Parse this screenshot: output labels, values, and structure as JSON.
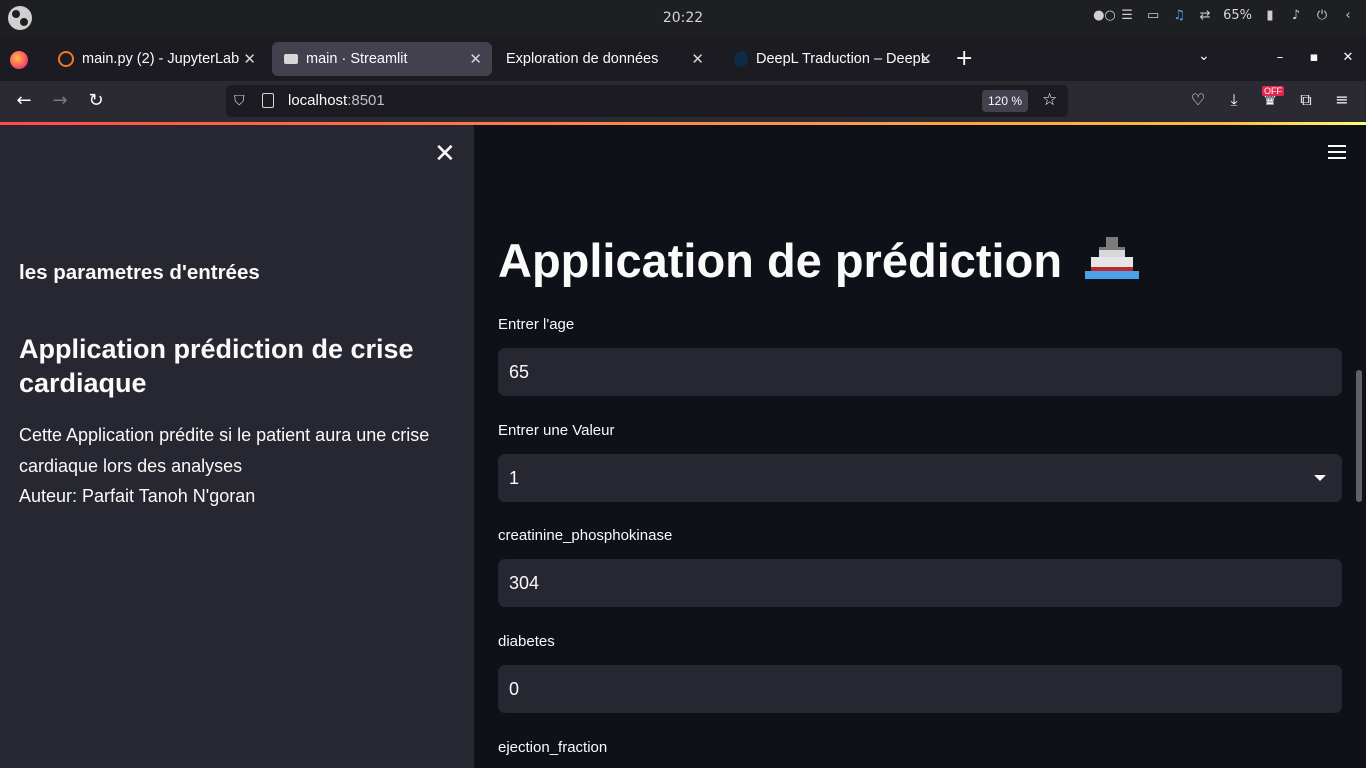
{
  "os": {
    "clock": "20:22",
    "battery": "65%"
  },
  "browser": {
    "tabs": [
      {
        "label": "main.py (2) - JupyterLab",
        "active": false
      },
      {
        "label": "main · Streamlit",
        "active": true
      },
      {
        "label": "Exploration de données",
        "active": false
      },
      {
        "label": "DeepL Traduction – DeepL",
        "active": false
      }
    ],
    "url_host": "localhost",
    "url_port": ":8501",
    "zoom": "120 %",
    "extension_badge": "OFF"
  },
  "sidebar": {
    "params_heading": "les parametres d'entrées",
    "title": "Application prédiction de crise cardiaque",
    "description_line1": "Cette Application prédite si le patient aura une crise cardiaque lors des analyses",
    "author": "Auteur: Parfait Tanoh N'goran"
  },
  "main": {
    "title": "Application de prédiction",
    "fields": [
      {
        "label": "Entrer l'age",
        "value": "65",
        "type": "input"
      },
      {
        "label": "Entrer une Valeur",
        "value": "1",
        "type": "select"
      },
      {
        "label": "creatinine_phosphokinase",
        "value": "304",
        "type": "input"
      },
      {
        "label": "diabetes",
        "value": "0",
        "type": "input"
      },
      {
        "label": "ejection_fraction",
        "value": "",
        "type": "input"
      }
    ]
  },
  "colors": {
    "sidebar_bg": "#262730",
    "main_bg": "#0e1117",
    "field_bg": "#262730",
    "accent_gradient_start": "#ff4b4b"
  }
}
